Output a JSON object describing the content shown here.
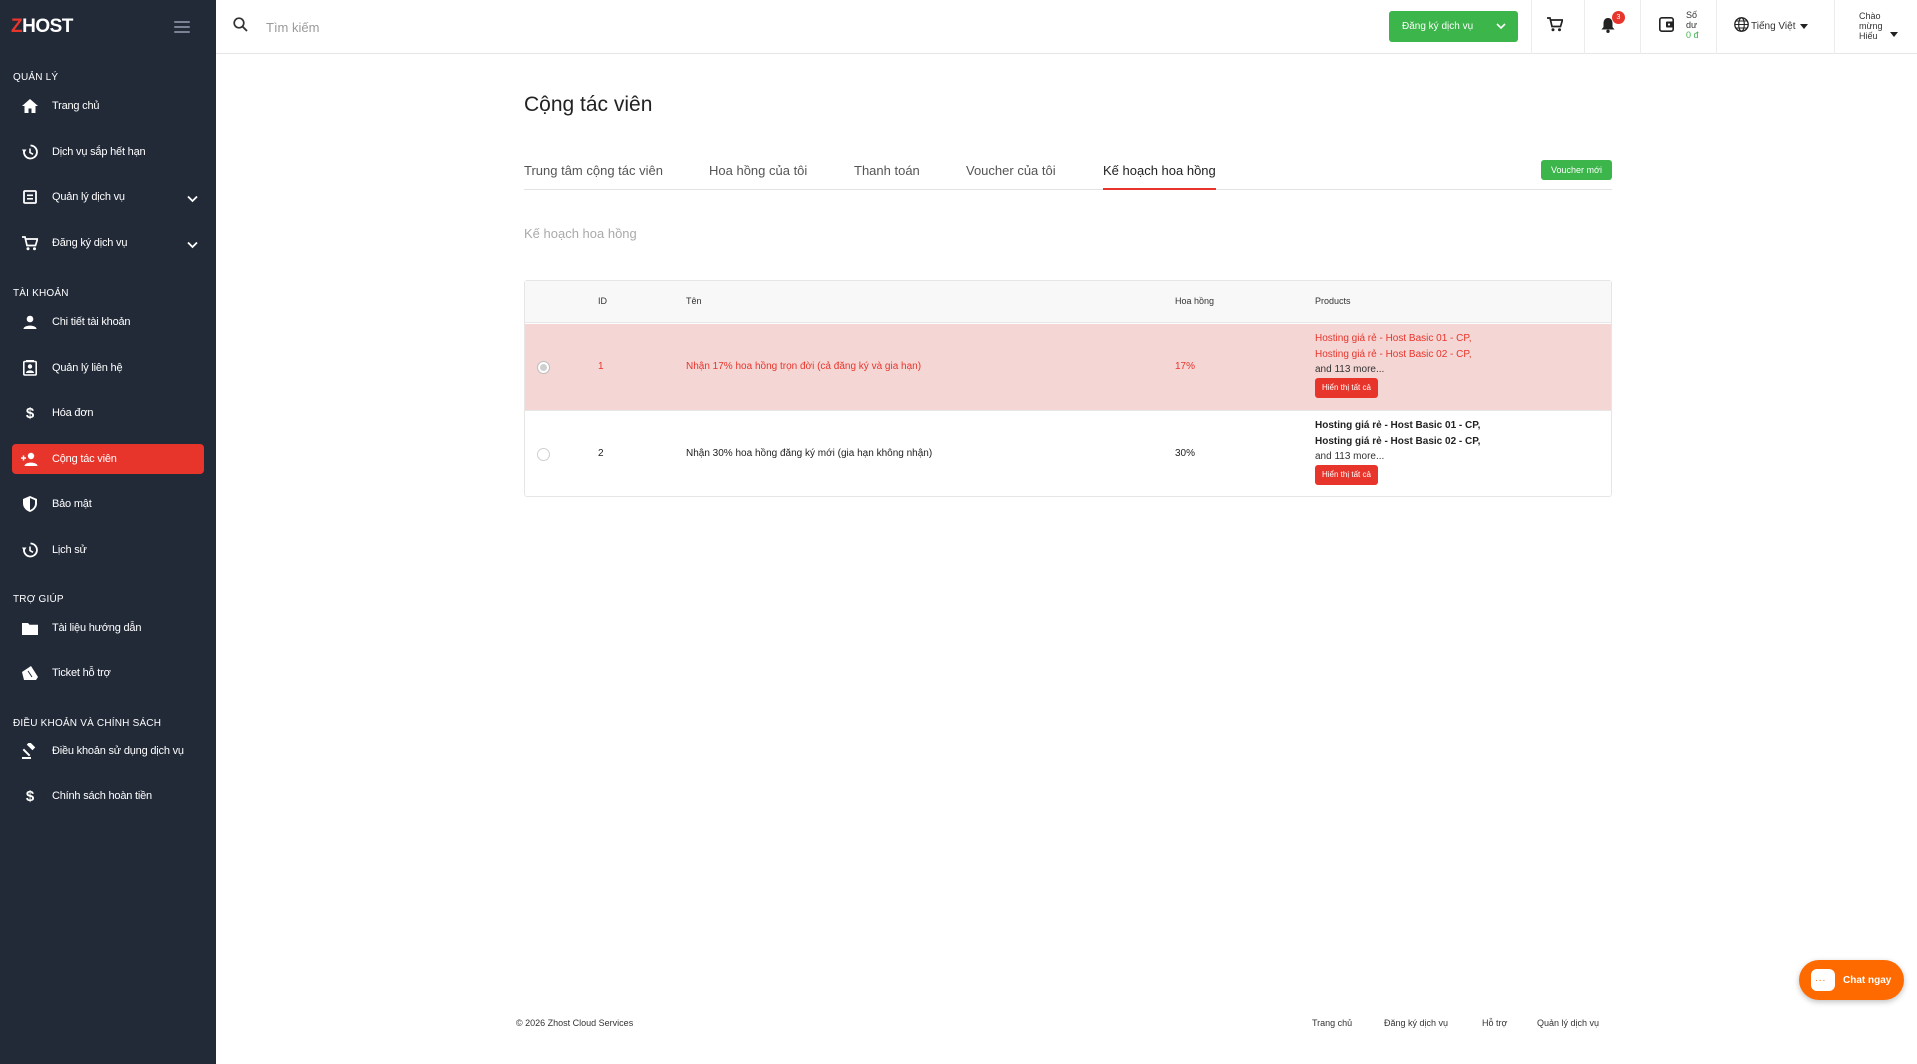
{
  "brand": {
    "logo_z": "Z",
    "logo_rest": "HOST"
  },
  "sidebar": {
    "sections": [
      {
        "title": "QUẢN LÝ"
      },
      {
        "title": "TÀI KHOẢN"
      },
      {
        "title": "TRỢ GIÚP"
      },
      {
        "title": "ĐIỀU KHOẢN VÀ CHÍNH SÁCH"
      }
    ],
    "items": [
      {
        "label": "Trang chủ",
        "icon": "home-icon"
      },
      {
        "label": "Dịch vụ sắp hết hạn",
        "icon": "history-icon"
      },
      {
        "label": "Quản lý dịch vụ",
        "icon": "service-icon"
      },
      {
        "label": "Đăng ký dịch vụ",
        "icon": "cart-icon"
      },
      {
        "label": "Chi tiết tài khoản",
        "icon": "user-icon"
      },
      {
        "label": "Quản lý liên hệ",
        "icon": "contact-icon"
      },
      {
        "label": "Hóa đơn",
        "icon": "dollar-icon"
      },
      {
        "label": "Cộng tác viên",
        "icon": "user-plus-icon"
      },
      {
        "label": "Bảo mật",
        "icon": "shield-icon"
      },
      {
        "label": "Lịch sử",
        "icon": "history-icon"
      },
      {
        "label": "Tài liệu hướng dẫn",
        "icon": "folder-icon"
      },
      {
        "label": "Ticket hỗ trợ",
        "icon": "ticket-icon"
      },
      {
        "label": "Điều khoản sử dụng dịch vụ",
        "icon": "gavel-icon"
      },
      {
        "label": "Chính sách hoàn tiền",
        "icon": "dollar-icon"
      }
    ],
    "active_index": 7
  },
  "topbar": {
    "search_placeholder": "Tìm kiếm",
    "register_label": "Đăng ký dịch vụ",
    "notification_count": "3",
    "balance_label_1": "Số",
    "balance_label_2": "dư",
    "balance_amount": "0 đ",
    "language": "Tiếng Việt",
    "greeting_1": "Chào",
    "greeting_2": "mừng",
    "greeting_3": "Hiếu"
  },
  "main": {
    "title": "Cộng tác viên",
    "tabs": [
      {
        "label": "Trung tâm cộng tác viên"
      },
      {
        "label": "Hoa hồng của tôi"
      },
      {
        "label": "Thanh toán"
      },
      {
        "label": "Voucher của tôi"
      },
      {
        "label": "Kế hoạch hoa hồng"
      }
    ],
    "voucher_button": "Voucher mới",
    "subtitle": "Kế hoạch hoa hồng",
    "table": {
      "headers": [
        "ID",
        "Tên",
        "Hoa hồng",
        "Products"
      ],
      "rows": [
        {
          "id": "1",
          "name": "Nhận 17% hoa hồng trọn đời (cả đăng ký và gia hạn)",
          "commission": "17%",
          "products": [
            "Hosting giá rẻ - Host Basic 01 - CP,",
            "Hosting giá rẻ - Host Basic 02 - CP,"
          ],
          "more": "and 113 more...",
          "show_all": "Hiển thị tất cả"
        },
        {
          "id": "2",
          "name": "Nhận 30% hoa hồng đăng ký mới (gia hạn không nhận)",
          "commission": "30%",
          "products": [
            "Hosting giá rẻ - Host Basic 01 - CP,",
            "Hosting giá rẻ - Host Basic 02 - CP,"
          ],
          "more": "and 113 more...",
          "show_all": "Hiển thị tất cả"
        }
      ]
    }
  },
  "footer": {
    "copyright": "© 2026 Zhost Cloud Services",
    "links": [
      "Trang chủ",
      "Đăng ký dịch vụ",
      "Hỗ trợ",
      "Quản lý dịch vụ"
    ]
  },
  "chat": {
    "label": "Chat ngay"
  },
  "colors": {
    "accent": "#e8352b",
    "success": "#3cb54a",
    "sidebar_bg": "#222a38",
    "chat": "#ff6a00"
  }
}
